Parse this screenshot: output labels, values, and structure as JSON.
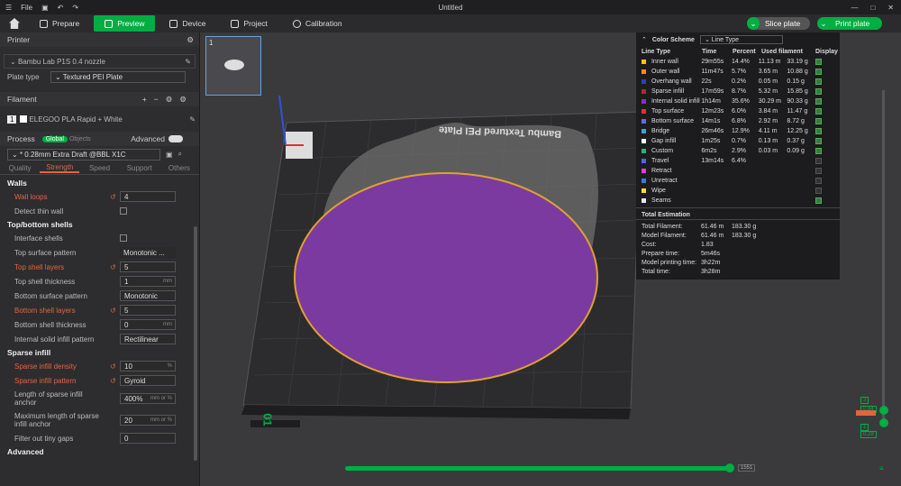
{
  "titlebar": {
    "file_label": "File",
    "title": "Untitled"
  },
  "tabs": [
    {
      "label": "Prepare"
    },
    {
      "label": "Preview"
    },
    {
      "label": "Device"
    },
    {
      "label": "Project"
    },
    {
      "label": "Calibration"
    }
  ],
  "actions": {
    "slice": "Slice plate",
    "print": "Print plate"
  },
  "printer": {
    "header": "Printer",
    "name": "Bambu Lab P1S 0.4 nozzle",
    "plate_label": "Plate type",
    "plate_value": "Textured PEI Plate"
  },
  "filament": {
    "header": "Filament",
    "slot": "1",
    "name": "ELEGOO PLA Rapid + White"
  },
  "process": {
    "header": "Process",
    "global": "Global",
    "objects": "Objects",
    "advanced": "Advanced",
    "profile": "* 0.28mm Extra Draft @BBL X1C",
    "tabs": [
      "Quality",
      "Strength",
      "Speed",
      "Support",
      "Others"
    ]
  },
  "walls": {
    "header": "Walls",
    "loops_label": "Wall loops",
    "loops": "4",
    "thin_label": "Detect thin wall"
  },
  "topbottom": {
    "header": "Top/bottom shells",
    "interface_label": "Interface shells",
    "top_pattern_label": "Top surface pattern",
    "top_pattern": "Monotonic ...",
    "top_layers_label": "Top shell layers",
    "top_layers": "5",
    "top_thick_label": "Top shell thickness",
    "top_thick": "1",
    "mm": "mm",
    "bottom_pattern_label": "Bottom surface pattern",
    "bottom_pattern": "Monotonic",
    "bottom_layers_label": "Bottom shell layers",
    "bottom_layers": "5",
    "bottom_thick_label": "Bottom shell thickness",
    "bottom_thick": "0",
    "internal_label": "Internal solid infill pattern",
    "internal": "Rectilinear"
  },
  "sparse": {
    "header": "Sparse infill",
    "density_label": "Sparse infill density",
    "density": "10",
    "pct": "%",
    "pattern_label": "Sparse infill pattern",
    "pattern": "Gyroid",
    "anchor_label": "Length of sparse infill anchor",
    "anchor": "400%",
    "anchor_unit": "mm or %",
    "maxanchor_label": "Maximum length of sparse infill anchor",
    "maxanchor": "20",
    "gaps_label": "Filter out tiny gaps",
    "gaps": "0"
  },
  "advanced_header": "Advanced",
  "thumb_index": "1",
  "legend": {
    "title": "Color Scheme",
    "scheme": "Line Type",
    "headers": [
      "Line Type",
      "Time",
      "Percent",
      "Used filament",
      "Display"
    ],
    "rows": [
      {
        "name": "Inner wall",
        "time": "29m55s",
        "pct": "14.4%",
        "len": "11.13 m",
        "g": "33.19 g",
        "color": "#f5c518",
        "on": true
      },
      {
        "name": "Outer wall",
        "time": "11m47s",
        "pct": "5.7%",
        "len": "3.65 m",
        "g": "10.88 g",
        "color": "#f08a2a",
        "on": true
      },
      {
        "name": "Overhang wall",
        "time": "22s",
        "pct": "0.2%",
        "len": "0.05 m",
        "g": "0.15 g",
        "color": "#2a3fc8",
        "on": true
      },
      {
        "name": "Sparse infill",
        "time": "17m59s",
        "pct": "8.7%",
        "len": "5.32 m",
        "g": "15.85 g",
        "color": "#a0322a",
        "on": true
      },
      {
        "name": "Internal solid infill",
        "time": "1h14m",
        "pct": "35.6%",
        "len": "30.29 m",
        "g": "90.33 g",
        "color": "#8a2fbe",
        "on": true
      },
      {
        "name": "Top surface",
        "time": "12m23s",
        "pct": "6.0%",
        "len": "3.84 m",
        "g": "11.47 g",
        "color": "#e0342a",
        "on": true
      },
      {
        "name": "Bottom surface",
        "time": "14m1s",
        "pct": "6.8%",
        "len": "2.92 m",
        "g": "8.72 g",
        "color": "#6a6ad8",
        "on": true
      },
      {
        "name": "Bridge",
        "time": "26m46s",
        "pct": "12.9%",
        "len": "4.11 m",
        "g": "12.25 g",
        "color": "#4aa0c8",
        "on": true
      },
      {
        "name": "Gap infill",
        "time": "1m25s",
        "pct": "0.7%",
        "len": "0.13 m",
        "g": "0.37 g",
        "color": "#ffffff",
        "on": true
      },
      {
        "name": "Custom",
        "time": "6m2s",
        "pct": "2.9%",
        "len": "0.03 m",
        "g": "0.09 g",
        "color": "#2ab07a",
        "on": true
      },
      {
        "name": "Travel",
        "time": "13m14s",
        "pct": "6.4%",
        "len": "",
        "g": "",
        "color": "#4a6ae0",
        "on": false
      },
      {
        "name": "Retract",
        "time": "",
        "pct": "",
        "len": "",
        "g": "",
        "color": "#e03ae0",
        "on": false
      },
      {
        "name": "Unretract",
        "time": "",
        "pct": "",
        "len": "",
        "g": "",
        "color": "#3a7ae0",
        "on": false
      },
      {
        "name": "Wipe",
        "time": "",
        "pct": "",
        "len": "",
        "g": "",
        "color": "#f5e02a",
        "on": false
      },
      {
        "name": "Seams",
        "time": "",
        "pct": "",
        "len": "",
        "g": "",
        "color": "#e8e8e8",
        "on": true
      }
    ],
    "est_header": "Total Estimation",
    "est": [
      {
        "k": "Total Filament:",
        "a": "61.46 m",
        "b": "183.30 g"
      },
      {
        "k": "Model Filament:",
        "a": "61.46 m",
        "b": "183.30 g"
      },
      {
        "k": "Cost:",
        "a": "1.83",
        "b": ""
      },
      {
        "k": "Prepare time:",
        "a": "5m46s",
        "b": ""
      },
      {
        "k": "Model printing time:",
        "a": "3h22m",
        "b": ""
      },
      {
        "k": "Total time:",
        "a": "3h28m",
        "b": ""
      }
    ]
  },
  "plate_label": "Bambu Textured PEI Plate",
  "plate_number": "01",
  "slider": {
    "layer_top": "3",
    "height": "0.84",
    "height2": "0.28",
    "bottom": "1",
    "hval": "1551"
  }
}
